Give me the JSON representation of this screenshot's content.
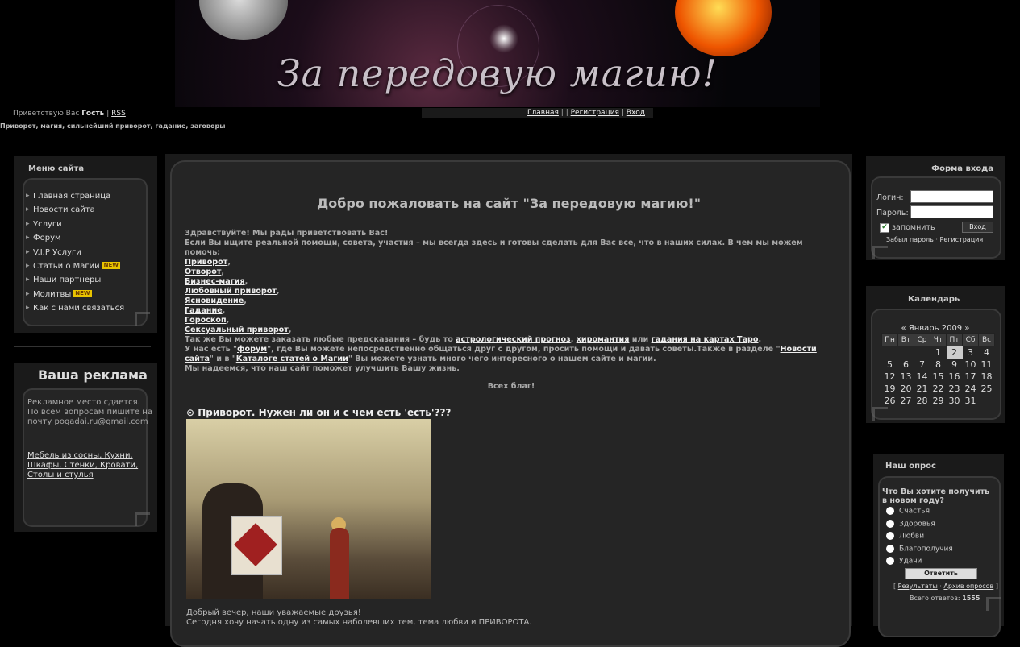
{
  "banner": {
    "title": "За передовую магию!"
  },
  "greeting": {
    "prefix": "Приветствую Вас",
    "user": "Гость",
    "sep": "|",
    "rss": "RSS"
  },
  "tagline": "Приворот, магия, сильнейший приворот, гадание, заговоры",
  "topnav": {
    "home": "Главная",
    "sep1": "| |",
    "register": "Регистрация",
    "sep2": "|",
    "login": "Вход"
  },
  "menu": {
    "title": "Меню сайта",
    "items": [
      {
        "label": "Главная страница"
      },
      {
        "label": "Новости сайта"
      },
      {
        "label": "Услуги"
      },
      {
        "label": "Форум"
      },
      {
        "label": "V.I.P Услуги"
      },
      {
        "label": "Статьи о Магии",
        "badge": "NEW"
      },
      {
        "label": "Наши партнеры"
      },
      {
        "label": "Молитвы",
        "badge": "NEW"
      },
      {
        "label": "Как с нами связаться"
      }
    ]
  },
  "ads": {
    "title": "Ваша реклама",
    "text": "Рекламное место сдается. По всем вопросам пишите на почту pogadai.ru@gmail.com",
    "link": "Мебель из сосны, Кухни, Шкафы, Стенки, Кровати, Столы и стулья"
  },
  "main": {
    "welcome": "Добро пожаловать на сайт \"За передовую магию!\"",
    "hello": "Здравствуйте! Мы рады приветствовать Вас!",
    "intro": "Если Вы ищите реальной помощи, совета, участия – мы всегда здесь и готовы сделать для Вас все, что в наших силах. В чем мы можем помочь:",
    "services": [
      "Приворот",
      "Отворот",
      "Бизнес-магия",
      "Любовный приворот",
      "Ясновидение",
      "Гадание",
      "Гороскоп",
      "Сексуальный приворот"
    ],
    "predict_pre": "Так же Вы можете заказать любые предсказания – будь то ",
    "predict_links": [
      "астрологический прогноз",
      "хиромантия",
      "гадания на картах Таро"
    ],
    "forum_pre": "У нас есть \"",
    "forum_link": "форум",
    "forum_post": "\", где Вы можете непосредственно общаться друг с другом, просить помощи и давать советы.Также в разделе \"",
    "news_link": "Новости сайта",
    "news_post": "\" и в \"",
    "catalog_link": "Каталоге статей о Магии",
    "catalog_post": "\" Вы можете узнать много чего интересного о нашем сайте и магии.",
    "hope": "Мы надеемся, что наш сайт поможет улучшить Вашу жизнь.",
    "bless": "Всех благ!",
    "post_title": "Приворот. Нужен ли он и с чем есть 'есть'???",
    "post_line1": "Добрый вечер, наши уважаемые друзья!",
    "post_line2": "Сегодня хочу начать одну из самых наболевших тем, тема любви и ПРИВОРОТА."
  },
  "login": {
    "title": "Форма входа",
    "login_label": "Логин:",
    "pass_label": "Пароль:",
    "remember": "запомнить",
    "submit": "Вход",
    "forgot": "Забыл пароль",
    "dot": "·",
    "register": "Регистрация"
  },
  "calendar": {
    "title": "Календарь",
    "prev": "«",
    "month": "Январь 2009",
    "next": "»",
    "days": [
      "Пн",
      "Вт",
      "Ср",
      "Чт",
      "Пт",
      "Сб",
      "Вс"
    ],
    "weeks": [
      [
        "",
        "",
        "",
        "1",
        "2",
        "3",
        "4"
      ],
      [
        "5",
        "6",
        "7",
        "8",
        "9",
        "10",
        "11"
      ],
      [
        "12",
        "13",
        "14",
        "15",
        "16",
        "17",
        "18"
      ],
      [
        "19",
        "20",
        "21",
        "22",
        "23",
        "24",
        "25"
      ],
      [
        "26",
        "27",
        "28",
        "29",
        "30",
        "31",
        ""
      ]
    ],
    "today": "2"
  },
  "poll": {
    "title": "Наш опрос",
    "question": "Что Вы хотите получить в новом году?",
    "options": [
      "Счастья",
      "Здоровья",
      "Любви",
      "Благополучия",
      "Удачи"
    ],
    "vote": "Ответить",
    "results": "Результаты",
    "dot": "·",
    "archive": "Архив опросов",
    "lb": "[",
    "rb": "]",
    "total_label": "Всего ответов:",
    "total": "1555"
  }
}
